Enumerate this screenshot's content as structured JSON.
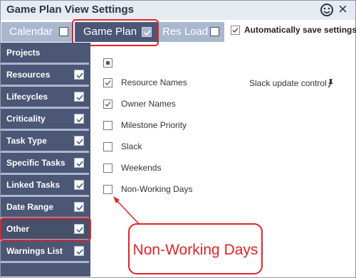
{
  "window": {
    "title": "Game Plan View Settings",
    "icons": [
      "smiley-icon",
      "close-icon"
    ]
  },
  "tabs": [
    {
      "label": "Calendar",
      "checked": false
    },
    {
      "label": "Game Plan",
      "checked": true
    },
    {
      "label": "Res Load",
      "checked": false
    }
  ],
  "autosave": {
    "label": "Automatically save settings",
    "checked": true
  },
  "sidebar": {
    "items": [
      {
        "label": "Projects",
        "checked": null
      },
      {
        "label": "Resources",
        "checked": true
      },
      {
        "label": "Lifecycles",
        "checked": true
      },
      {
        "label": "Criticality",
        "checked": true
      },
      {
        "label": "Task Type",
        "checked": true
      },
      {
        "label": "Specific Tasks",
        "checked": true
      },
      {
        "label": "Linked Tasks",
        "checked": true
      },
      {
        "label": "Date Range",
        "checked": true
      },
      {
        "label": "Other",
        "checked": true,
        "active": true
      },
      {
        "label": "Warnings List",
        "checked": true
      }
    ]
  },
  "content": {
    "options": [
      {
        "label": "Resource Names",
        "checked": true
      },
      {
        "label": "Owner Names",
        "checked": true
      },
      {
        "label": "Milestone Priority",
        "checked": false
      },
      {
        "label": "Slack",
        "checked": false
      },
      {
        "label": "Weekends",
        "checked": false
      },
      {
        "label": "Non-Working Days",
        "checked": false
      }
    ],
    "slack_control_label": "Slack update control"
  },
  "callout": {
    "text": "Non-Working Days"
  },
  "colors": {
    "accent": "#4b5775",
    "highlight": "#e32227",
    "tab_inactive": "#a9b7cf"
  }
}
